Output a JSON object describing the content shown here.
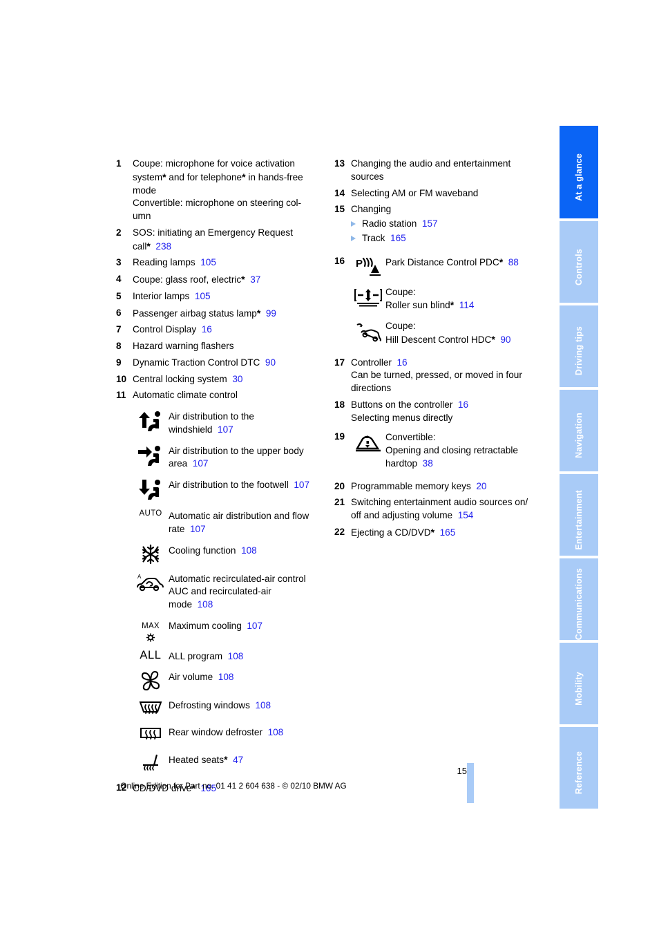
{
  "page": {
    "number": "15",
    "footer_text": "Online Edition for Part no. 01 41 2 604 638 - © 02/10 BMW AG",
    "ref_color": "#2222ee",
    "active_tab_color": "#0a64f5",
    "inactive_tab_color": "#a9cbf7"
  },
  "sidebar": {
    "tabs": [
      {
        "label": "At a glance",
        "active": true
      },
      {
        "label": "Controls",
        "active": false
      },
      {
        "label": "Driving tips",
        "active": false
      },
      {
        "label": "Navigation",
        "active": false
      },
      {
        "label": "Entertainment",
        "active": false
      },
      {
        "label": "Communications",
        "active": false
      },
      {
        "label": "Mobility",
        "active": false
      },
      {
        "label": "Reference",
        "active": false
      }
    ]
  },
  "left_column": {
    "item1": {
      "num": "1",
      "line1_a": "Coupe: microphone for voice activation",
      "line1_b": "system",
      "line1_c": " and for telephone",
      "line1_d": " in hands-free",
      "line1_e": "mode",
      "line2": "Convertible: microphone on steering col-",
      "line3": "umn"
    },
    "item2": {
      "num": "2",
      "text_a": "SOS: initiating an Emergency Request",
      "text_b": "call",
      "ref": "238"
    },
    "item3": {
      "num": "3",
      "text": "Reading lamps",
      "ref": "105"
    },
    "item4": {
      "num": "4",
      "text": "Coupe: glass roof, electric",
      "ref": "37"
    },
    "item5": {
      "num": "5",
      "text": "Interior lamps",
      "ref": "105"
    },
    "item6": {
      "num": "6",
      "text": "Passenger airbag status lamp",
      "ref": "99"
    },
    "item7": {
      "num": "7",
      "text": "Control Display",
      "ref": "16"
    },
    "item8": {
      "num": "8",
      "text": "Hazard warning flashers",
      "ref": ""
    },
    "item9": {
      "num": "9",
      "text": "Dynamic Traction Control DTC",
      "ref": "90"
    },
    "item10": {
      "num": "10",
      "text": "Central locking system",
      "ref": "30"
    },
    "item11": {
      "num": "11",
      "text": "Automatic climate control"
    },
    "item12": {
      "num": "12",
      "text": "CD/DVD drive",
      "ref": "165"
    },
    "climate_icons": [
      {
        "icon": "air-distribution-windshield-icon",
        "line1": "Air distribution to the",
        "line2": "windshield",
        "ref": "107"
      },
      {
        "icon": "air-distribution-upper-body-icon",
        "line1": "Air distribution to the upper body",
        "line2": "area",
        "ref": "107"
      },
      {
        "icon": "air-distribution-footwell-icon",
        "line1": "Air distribution to the footwell",
        "line2": "",
        "ref": "107"
      },
      {
        "icon": "auto-text-icon",
        "icon_text": "AUTO",
        "line1": "Automatic air distribution and flow",
        "line2": "rate",
        "ref": "107"
      },
      {
        "icon": "snowflake-cooling-icon",
        "line1": "Cooling function",
        "line2": "",
        "ref": "108"
      },
      {
        "icon": "recirculated-air-car-icon",
        "line1": "Automatic recirculated-air control",
        "line2": "AUC and recirculated-air",
        "line3": "mode",
        "ref": "108"
      },
      {
        "icon": "max-cooling-icon",
        "icon_text": "MAX",
        "line1": "Maximum cooling",
        "line2": "",
        "ref": "107"
      },
      {
        "icon": "all-program-icon",
        "icon_text": "ALL",
        "line1": "ALL program",
        "line2": "",
        "ref": "108"
      },
      {
        "icon": "fan-air-volume-icon",
        "line1": "Air volume",
        "line2": "",
        "ref": "108"
      },
      {
        "icon": "defrost-windshield-icon",
        "line1": "Defrosting windows",
        "line2": "",
        "ref": "108"
      },
      {
        "icon": "rear-window-defroster-icon",
        "line1": "Rear window defroster",
        "line2": "",
        "ref": "108"
      },
      {
        "icon": "heated-seats-icon",
        "line1": "Heated seats",
        "line2": "",
        "ref": "47"
      }
    ]
  },
  "right_column": {
    "item13": {
      "num": "13",
      "line1": "Changing the audio and entertainment",
      "line2": "sources"
    },
    "item14": {
      "num": "14",
      "text": "Selecting AM or FM waveband"
    },
    "item15": {
      "num": "15",
      "text": "Changing",
      "subs": [
        {
          "label": "Radio station",
          "ref": "157"
        },
        {
          "label": "Track",
          "ref": "165"
        }
      ]
    },
    "item16": {
      "num": "16",
      "rows": [
        {
          "icon": "pdc-icon",
          "line1": "Park Distance Control PDC",
          "line2": "",
          "ref": "88",
          "has_star": true
        },
        {
          "icon": "roller-sun-blind-icon",
          "line1": "Coupe:",
          "line2": "Roller sun blind",
          "ref": "114",
          "has_star": true
        },
        {
          "icon": "hill-descent-control-icon",
          "line1": "Coupe:",
          "line2": "Hill Descent Control HDC",
          "ref": "90",
          "has_star": true
        }
      ]
    },
    "item17": {
      "num": "17",
      "text": "Controller",
      "ref": "16",
      "line2": "Can be turned, pressed, or moved in four",
      "line3": "directions"
    },
    "item18": {
      "num": "18",
      "text": "Buttons on the controller",
      "ref": "16",
      "line2": "Selecting menus directly"
    },
    "item19": {
      "num": "19",
      "icon": "retractable-hardtop-icon",
      "line1": "Convertible:",
      "line2": "Opening and closing retractable",
      "line3": "hardtop",
      "ref": "38"
    },
    "item20": {
      "num": "20",
      "text": "Programmable memory keys",
      "ref": "20"
    },
    "item21": {
      "num": "21",
      "line1": "Switching entertainment audio sources on/",
      "line2": "off and adjusting volume",
      "ref": "154"
    },
    "item22": {
      "num": "22",
      "text": "Ejecting a CD/DVD",
      "ref": "165"
    }
  }
}
